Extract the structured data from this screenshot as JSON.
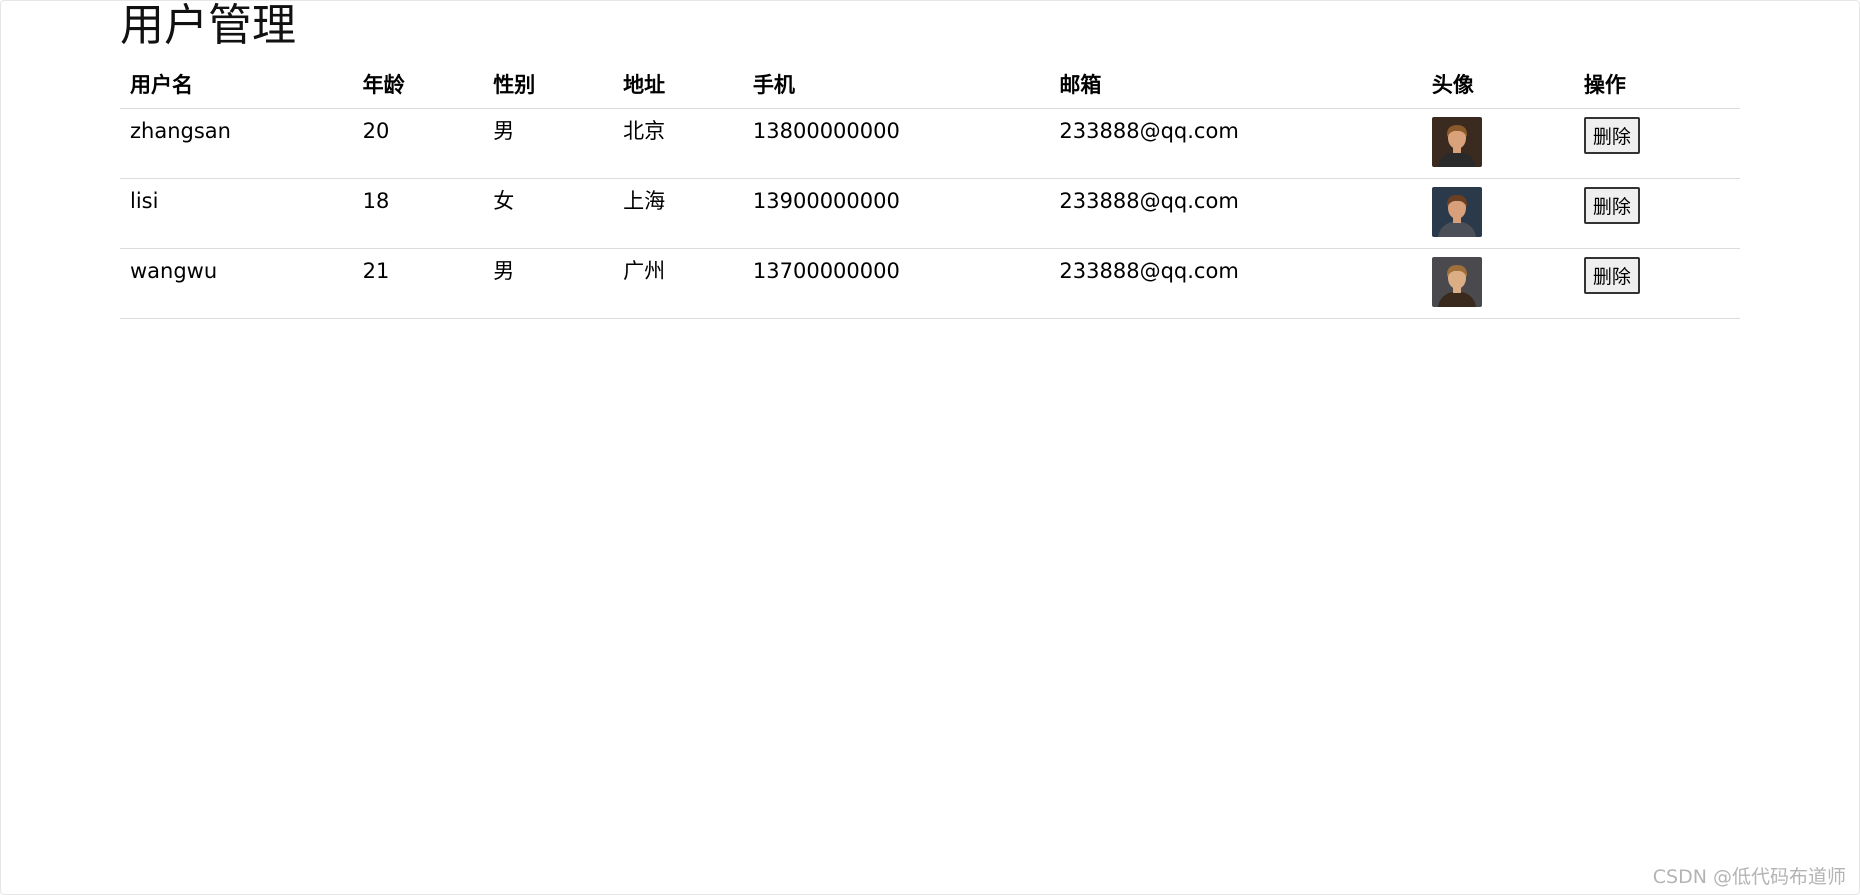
{
  "page": {
    "title": "用户管理",
    "watermark": "CSDN @低代码布道师"
  },
  "table": {
    "headers": {
      "username": "用户名",
      "age": "年龄",
      "gender": "性别",
      "address": "地址",
      "phone": "手机",
      "email": "邮箱",
      "avatar": "头像",
      "action": "操作"
    },
    "rows": [
      {
        "username": "zhangsan",
        "age": "20",
        "gender": "男",
        "address": "北京",
        "phone": "13800000000",
        "email": "233888@qq.com",
        "delete_label": "删除",
        "avatar_colors": {
          "bg": "#3b2a20",
          "hair": "#8a5a2b",
          "face": "#d9a27a",
          "shirt": "#2a2a2a"
        }
      },
      {
        "username": "lisi",
        "age": "18",
        "gender": "女",
        "address": "上海",
        "phone": "13900000000",
        "email": "233888@qq.com",
        "delete_label": "删除",
        "avatar_colors": {
          "bg": "#2b3a4a",
          "hair": "#6b3f22",
          "face": "#d8a07a",
          "shirt": "#4a4f58"
        }
      },
      {
        "username": "wangwu",
        "age": "21",
        "gender": "男",
        "address": "广州",
        "phone": "13700000000",
        "email": "233888@qq.com",
        "delete_label": "删除",
        "avatar_colors": {
          "bg": "#4a4a4e",
          "hair": "#a0703a",
          "face": "#dcae86",
          "shirt": "#3a2a1e"
        }
      }
    ]
  }
}
